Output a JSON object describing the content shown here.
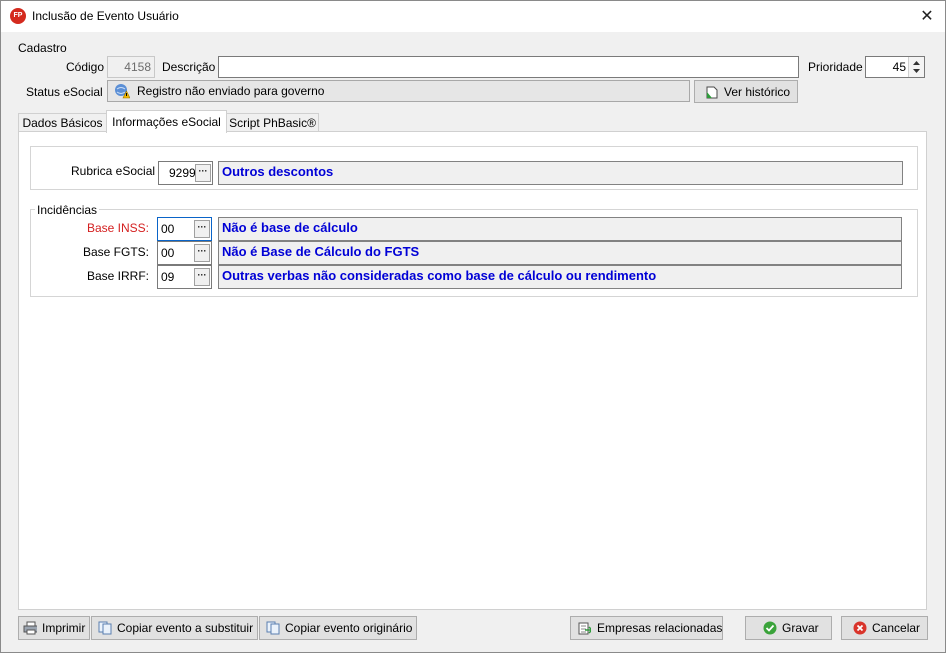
{
  "window": {
    "title": "Inclusão de Evento Usuário",
    "app_icon_text": "FP",
    "close_glyph": "✕"
  },
  "cadastro": {
    "group_label": "Cadastro",
    "codigo_label": "Código",
    "codigo_value": "4158",
    "descricao_label": "Descrição",
    "descricao_value": "",
    "prioridade_label": "Prioridade",
    "prioridade_value": "45",
    "status_label": "Status eSocial",
    "status_value": "Registro não enviado para governo",
    "ver_historico_label": "Ver histórico"
  },
  "tabs": [
    {
      "label": "Dados Básicos",
      "active": false
    },
    {
      "label": "Informações eSocial",
      "active": true
    },
    {
      "label": "Script PhBasic®",
      "active": false
    }
  ],
  "esocial": {
    "rubrica_label": "Rubrica eSocial",
    "rubrica_code": "9299",
    "rubrica_desc": "Outros descontos",
    "incidencias_label": "Incidências",
    "rows": [
      {
        "label": "Base INSS:",
        "code": "00",
        "desc": "Não é base de cálculo",
        "label_color": "#d42020"
      },
      {
        "label": "Base FGTS:",
        "code": "00",
        "desc": "Não é Base de Cálculo do FGTS",
        "label_color": "#000000"
      },
      {
        "label": "Base IRRF:",
        "code": "09",
        "desc": "Outras verbas não consideradas como base de cálculo ou rendimento",
        "label_color": "#000000"
      }
    ]
  },
  "footer": {
    "imprimir": "Imprimir",
    "copiar_substituir": "Copiar evento a substituir",
    "copiar_originario": "Copiar evento originário",
    "empresas": "Empresas relacionadas",
    "gravar": "Gravar",
    "cancelar": "Cancelar"
  },
  "ellipsis": "···"
}
